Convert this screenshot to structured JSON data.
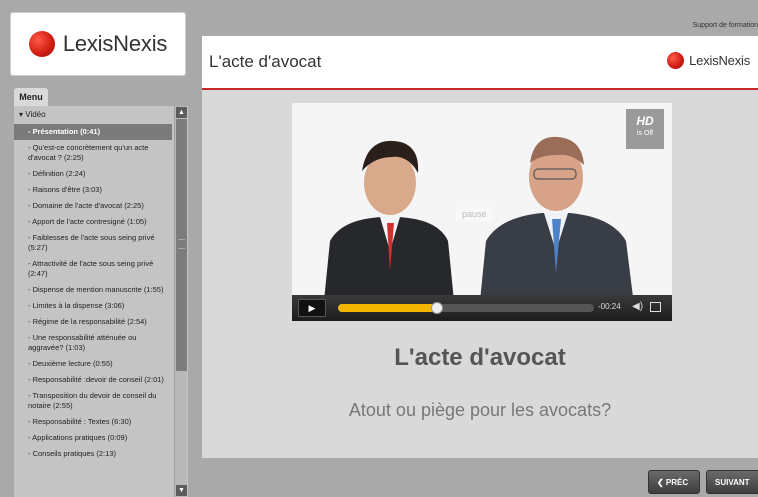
{
  "brand": {
    "logo_text": "LexisNexis",
    "accent": "#c62828"
  },
  "top_label": "Support de formation",
  "menu": {
    "tab_label": "Menu",
    "section": "Vidéo",
    "items": [
      "- Présentation (0:41)",
      "- Qu'est-ce concrètement qu'un acte d'avocat ? (2:25)",
      "- Définition (2:24)",
      "- Raisons d'être (3:03)",
      "- Domaine  de l'acte d'avocat (2:25)",
      "- Apport de l'acte contresigné (1:05)",
      "- Faiblesses de l'acte sous seing privé (5:27)",
      "- Attractivité de l'acte sous seing privé (2:47)",
      "- Dispense de mention manuscrite (1:55)",
      "- Limites à la dispense (3:06)",
      "- Régime de la responsabilité (2:54)",
      "- Une responsabilité atténuée ou aggravée? (1:03)",
      "- Deuxième lecture (0:55)",
      "- Responsabilité :devoir de conseil (2:01)",
      "- Transposition du devoir de conseil du notaire (2:55)",
      "- Responsabilité : Textes (6:30)",
      "- Applications pratiques (0:09)",
      "- Conseils pratiques (2:13)"
    ],
    "active_index": 0
  },
  "header": {
    "title": "L'acte d'avocat",
    "logo_text": "LexisNexis"
  },
  "video": {
    "hd_label": "HD",
    "hd_state": "is Off",
    "pause_ghost": "pause",
    "time": "-00:24",
    "progress": 0.385
  },
  "slide": {
    "title": "L'acte d'avocat",
    "subtitle": "Atout ou piège pour les avocats?"
  },
  "nav": {
    "prev": "❮  PRÉC",
    "next": "SUIVANT  ❯"
  }
}
